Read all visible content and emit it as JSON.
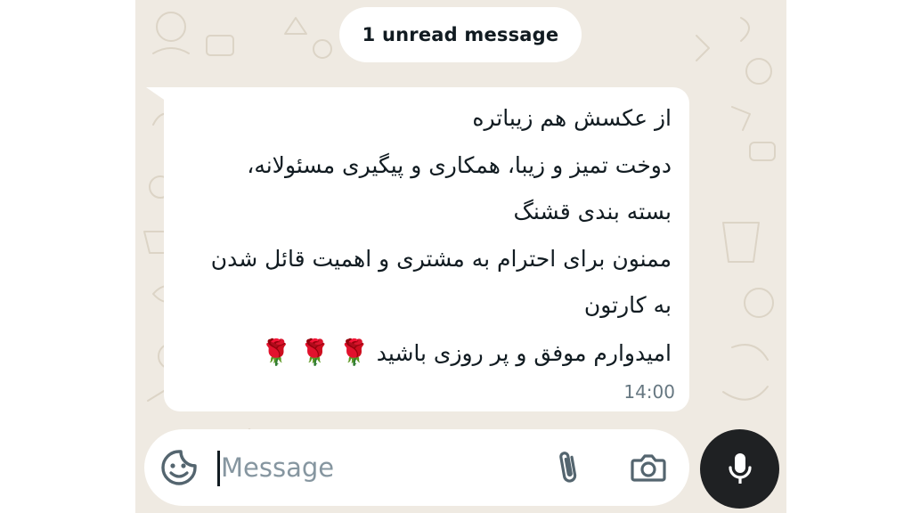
{
  "unread_banner": {
    "label": "1 unread message"
  },
  "message": {
    "lines": [
      "از عکسش هم زیباتره",
      "دوخت تمیز و زیبا، همکاری و پیگیری مسئولانه،",
      "بسته بندی قشنگ",
      "ممنون برای احترام به مشتری و اهمیت قائل شدن",
      "به کارتون",
      "امیدوارم موفق و پر روزی باشید"
    ],
    "emoji": "🌹 🌹 🌹",
    "time": "14:00"
  },
  "composer": {
    "placeholder": "Message",
    "value": "",
    "icons": {
      "sticker": "sticker-icon",
      "attach": "paperclip-icon",
      "camera": "camera-icon",
      "mic": "microphone-icon"
    }
  },
  "colors": {
    "wallpaper": "#efeae2",
    "bubble": "#ffffff",
    "text": "#111b21",
    "meta": "#667781",
    "icon": "#54656f",
    "mic_button": "#1f2123"
  }
}
